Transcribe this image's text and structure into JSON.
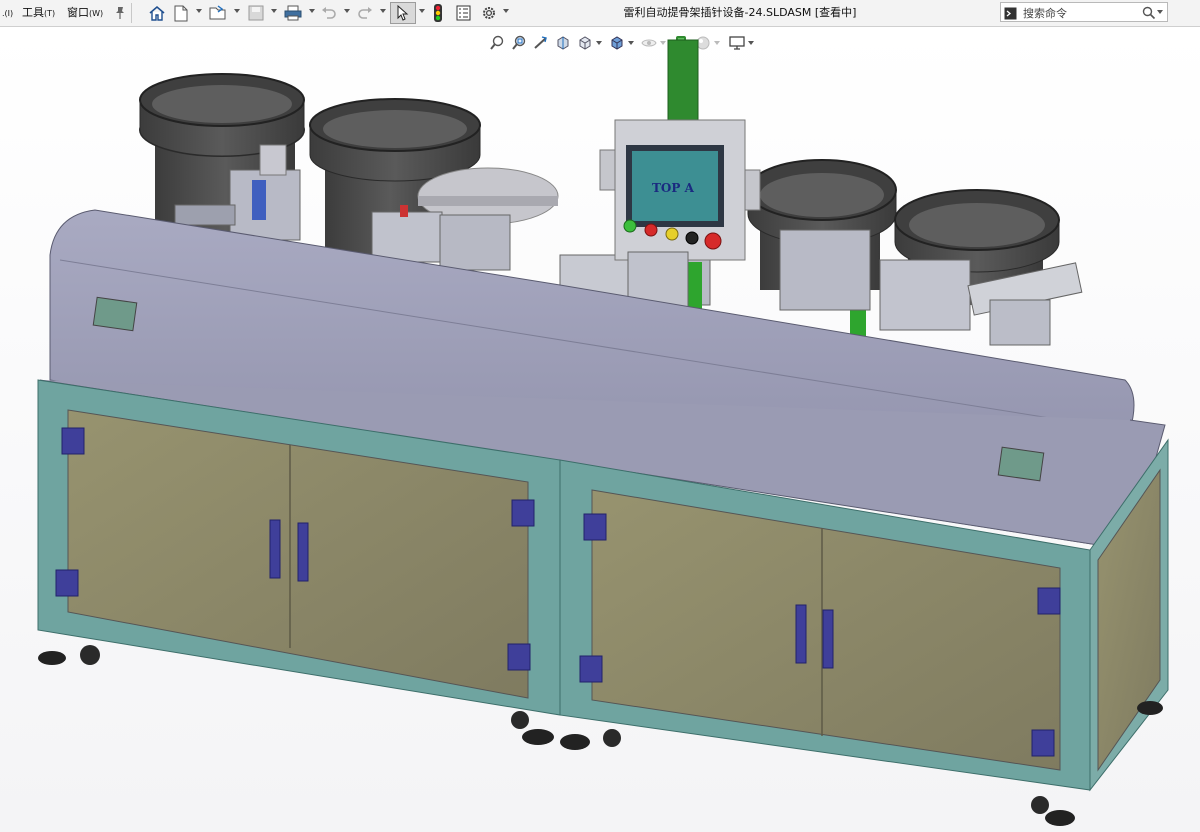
{
  "menus": {
    "partial_left": ".(I)",
    "tools": "工具",
    "tools_key": "(T)",
    "window": "窗口",
    "window_key": "(W)"
  },
  "icons": {
    "pin": "pin-icon",
    "home": "home-icon",
    "new": "new-document-icon",
    "open": "open-folder-icon",
    "save": "save-icon",
    "print": "print-icon",
    "undo": "undo-icon",
    "redo": "redo-icon",
    "select": "select-cursor-icon",
    "traffic": "rebuild-traffic-light-icon",
    "file_props": "file-properties-icon",
    "options": "gear-icon"
  },
  "document": {
    "title": "雷利自动提骨架插针设备-24.SLDASM [查看中]"
  },
  "search": {
    "placeholder": "搜索命令"
  },
  "heads_up": {
    "items": [
      "zoom-to-fit-icon",
      "zoom-to-area-icon",
      "previous-view-icon",
      "section-view-icon",
      "view-orientation-icon",
      "display-style-icon",
      "hide-show-items-icon",
      "edit-appearance-icon",
      "apply-scene-icon",
      "view-settings-icon"
    ]
  },
  "model": {
    "hmi_screen_text": "TOP  A",
    "colors": {
      "cover": "#8f90aa",
      "cover_top": "#a6a7bf",
      "frame": "#6fa4a0",
      "panel": "#8d8a6e",
      "bowl": "#4b4b4b",
      "tower_light": "#2f8a2f",
      "screen": "#3d8f93",
      "hinge": "#3f3f9a"
    },
    "buttons": [
      "green",
      "red",
      "yellow",
      "black",
      "red"
    ]
  }
}
